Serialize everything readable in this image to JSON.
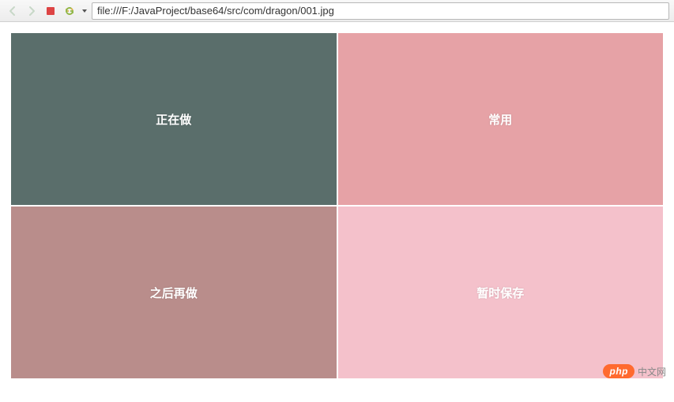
{
  "toolbar": {
    "address": "file:///F:/JavaProject/base64/src/com/dragon/001.jpg"
  },
  "tiles": {
    "top_left": "正在做",
    "top_right": "常用",
    "bottom_left": "之后再做",
    "bottom_right": "暂时保存"
  },
  "colors": {
    "tile1": "#5a6e6b",
    "tile2": "#e6a2a6",
    "tile3": "#b98d8b",
    "tile4": "#f4c1cb"
  },
  "watermark": {
    "badge": "php",
    "text": "中文网"
  }
}
